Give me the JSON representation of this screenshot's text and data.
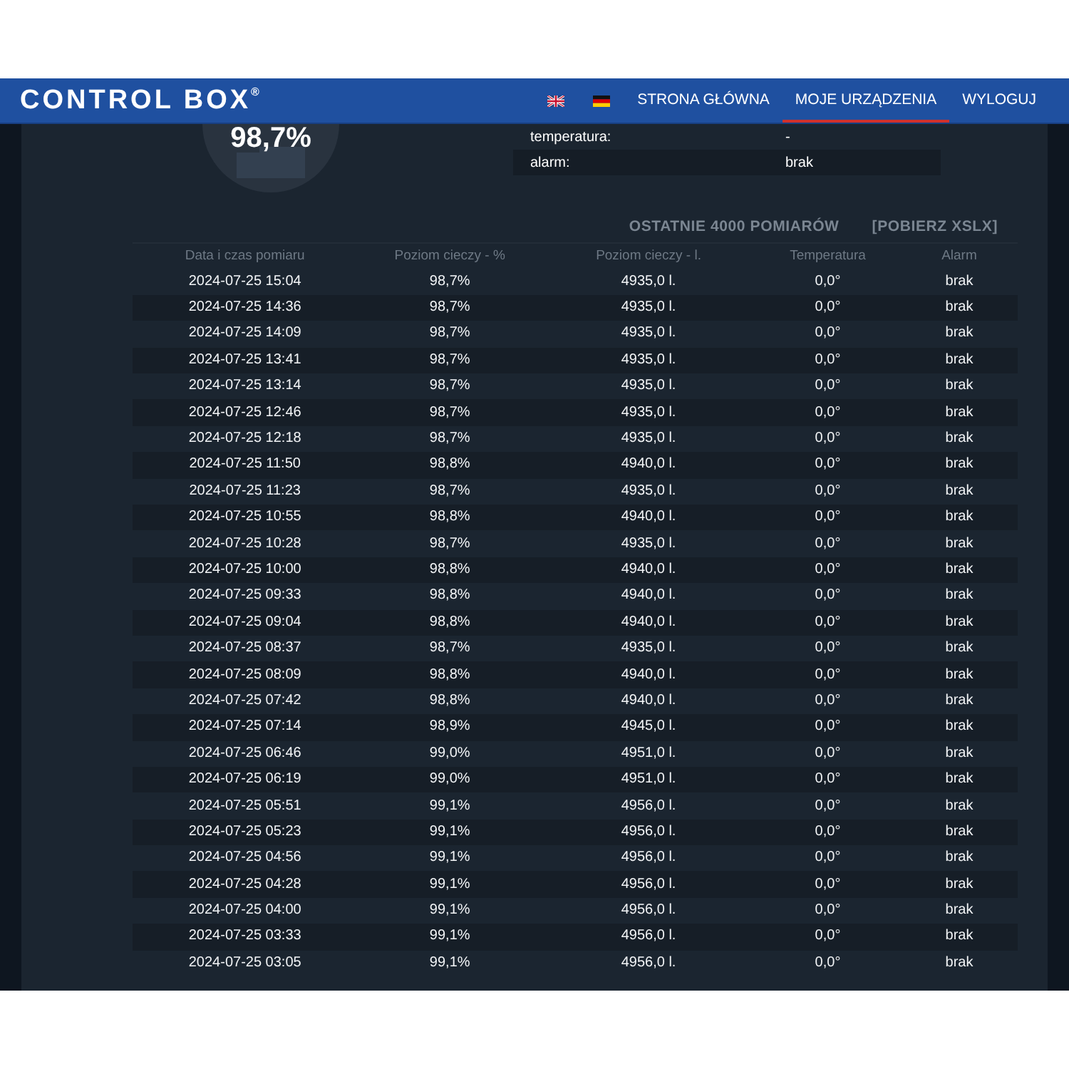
{
  "header": {
    "logo": "CONTROL BOX$^{®}$",
    "nav": [
      {
        "label": "STRONA GŁÓWNA",
        "selected": false
      },
      {
        "label": "MOJE URZĄDZENIA",
        "selected": true
      },
      {
        "label": "WYLOGUJ",
        "selected": false
      }
    ]
  },
  "gauge": {
    "reading": "98,7%"
  },
  "info": [
    {
      "label": "temperatura:",
      "value": "-"
    },
    {
      "label": "alarm:",
      "value": "brak"
    }
  ],
  "measurements": {
    "title": "OSTATNIE 4000 POMIARÓW",
    "download_link": "[POBIERZ XSLX]",
    "columns": [
      "Data i czas pomiaru",
      "Poziom cieczy - %",
      "Poziom cieczy - l.",
      "Temperatura",
      "Alarm"
    ],
    "rows": [
      [
        "2024-07-25 15:04",
        "98,7%",
        "4935,0 l.",
        "0,0°",
        "brak"
      ],
      [
        "2024-07-25 14:36",
        "98,7%",
        "4935,0 l.",
        "0,0°",
        "brak"
      ],
      [
        "2024-07-25 14:09",
        "98,7%",
        "4935,0 l.",
        "0,0°",
        "brak"
      ],
      [
        "2024-07-25 13:41",
        "98,7%",
        "4935,0 l.",
        "0,0°",
        "brak"
      ],
      [
        "2024-07-25 13:14",
        "98,7%",
        "4935,0 l.",
        "0,0°",
        "brak"
      ],
      [
        "2024-07-25 12:46",
        "98,7%",
        "4935,0 l.",
        "0,0°",
        "brak"
      ],
      [
        "2024-07-25 12:18",
        "98,7%",
        "4935,0 l.",
        "0,0°",
        "brak"
      ],
      [
        "2024-07-25 11:50",
        "98,8%",
        "4940,0 l.",
        "0,0°",
        "brak"
      ],
      [
        "2024-07-25 11:23",
        "98,7%",
        "4935,0 l.",
        "0,0°",
        "brak"
      ],
      [
        "2024-07-25 10:55",
        "98,8%",
        "4940,0 l.",
        "0,0°",
        "brak"
      ],
      [
        "2024-07-25 10:28",
        "98,7%",
        "4935,0 l.",
        "0,0°",
        "brak"
      ],
      [
        "2024-07-25 10:00",
        "98,8%",
        "4940,0 l.",
        "0,0°",
        "brak"
      ],
      [
        "2024-07-25 09:33",
        "98,8%",
        "4940,0 l.",
        "0,0°",
        "brak"
      ],
      [
        "2024-07-25 09:04",
        "98,8%",
        "4940,0 l.",
        "0,0°",
        "brak"
      ],
      [
        "2024-07-25 08:37",
        "98,7%",
        "4935,0 l.",
        "0,0°",
        "brak"
      ],
      [
        "2024-07-25 08:09",
        "98,8%",
        "4940,0 l.",
        "0,0°",
        "brak"
      ],
      [
        "2024-07-25 07:42",
        "98,8%",
        "4940,0 l.",
        "0,0°",
        "brak"
      ],
      [
        "2024-07-25 07:14",
        "98,9%",
        "4945,0 l.",
        "0,0°",
        "brak"
      ],
      [
        "2024-07-25 06:46",
        "99,0%",
        "4951,0 l.",
        "0,0°",
        "brak"
      ],
      [
        "2024-07-25 06:19",
        "99,0%",
        "4951,0 l.",
        "0,0°",
        "brak"
      ],
      [
        "2024-07-25 05:51",
        "99,1%",
        "4956,0 l.",
        "0,0°",
        "brak"
      ],
      [
        "2024-07-25 05:23",
        "99,1%",
        "4956,0 l.",
        "0,0°",
        "brak"
      ],
      [
        "2024-07-25 04:56",
        "99,1%",
        "4956,0 l.",
        "0,0°",
        "brak"
      ],
      [
        "2024-07-25 04:28",
        "99,1%",
        "4956,0 l.",
        "0,0°",
        "brak"
      ],
      [
        "2024-07-25 04:00",
        "99,1%",
        "4956,0 l.",
        "0,0°",
        "brak"
      ],
      [
        "2024-07-25 03:33",
        "99,1%",
        "4956,0 l.",
        "0,0°",
        "brak"
      ],
      [
        "2024-07-25 03:05",
        "99,1%",
        "4956,0 l.",
        "0,0°",
        "brak"
      ]
    ]
  }
}
